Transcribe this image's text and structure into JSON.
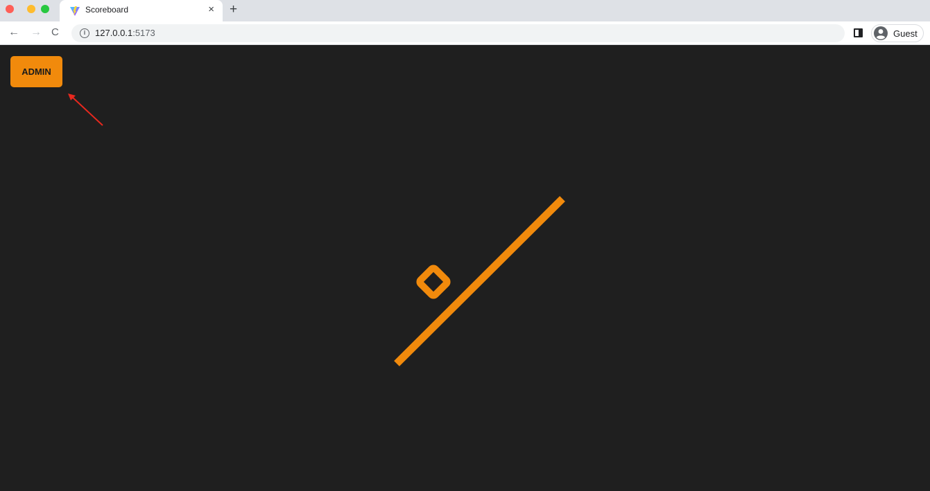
{
  "browser": {
    "tab": {
      "title": "Scoreboard",
      "close_glyph": "×",
      "favicon": "vite-logo-icon"
    },
    "new_tab_glyph": "+",
    "nav": {
      "back_glyph": "←",
      "forward_glyph": "→",
      "reload_glyph": "C"
    },
    "address_bar": {
      "host": "127.0.0.1",
      "port": ":5173",
      "info_glyph": "i"
    },
    "profile": {
      "label": "Guest"
    }
  },
  "page": {
    "admin_button_label": "ADMIN",
    "logo": "scoreboard-logo-icon",
    "annotation": "red-arrow-icon"
  },
  "colors": {
    "accent": "#f18a0c",
    "page_background": "#1f1f1f",
    "annotation_arrow": "#e8281e"
  }
}
